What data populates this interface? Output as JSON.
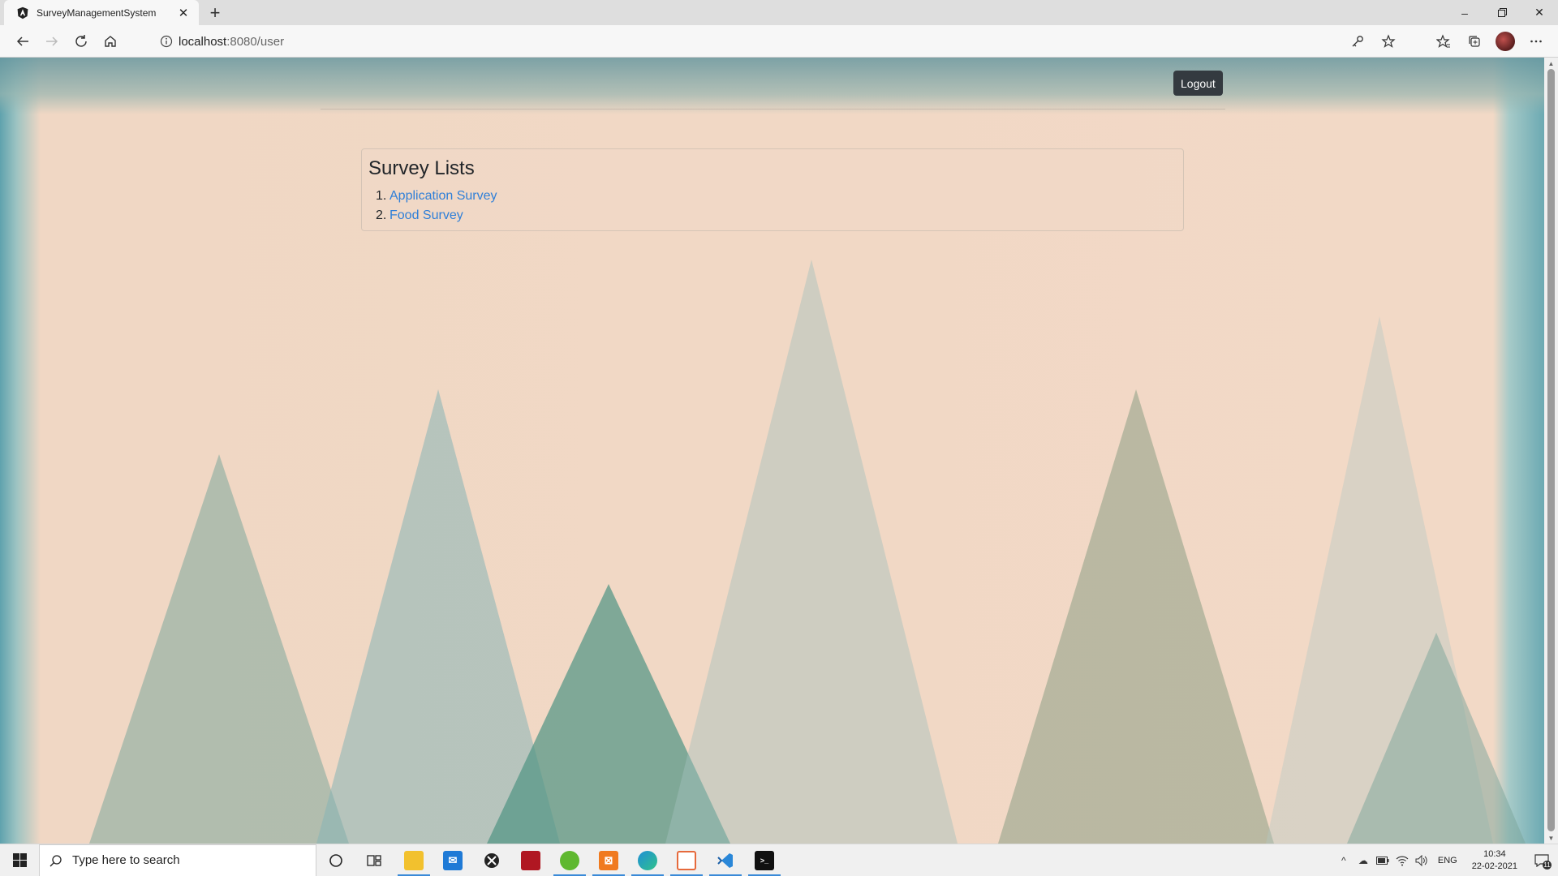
{
  "browser": {
    "tab_title": "SurveyManagementSystem",
    "url_host": "localhost",
    "url_path": ":8080/user"
  },
  "page": {
    "logout_label": "Logout",
    "card_title": "Survey Lists",
    "surveys": [
      {
        "num": "1.",
        "label": "Application Survey"
      },
      {
        "num": "2.",
        "label": "Food Survey"
      }
    ],
    "link_color": "#2f7fd8",
    "logout_bg": "#343a40"
  },
  "taskbar": {
    "search_placeholder": "Type here to search",
    "language": "ENG",
    "time": "10:34",
    "date": "22-02-2021",
    "notification_count": "11"
  }
}
